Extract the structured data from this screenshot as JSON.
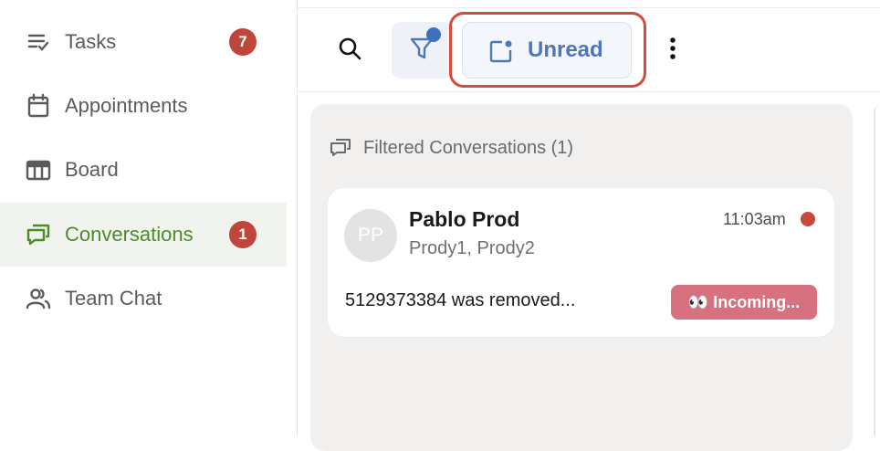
{
  "sidebar": {
    "items": [
      {
        "label": "Tasks",
        "icon": "tasks-icon",
        "badge": "7"
      },
      {
        "label": "Appointments",
        "icon": "calendar-icon"
      },
      {
        "label": "Board",
        "icon": "board-icon"
      },
      {
        "label": "Conversations",
        "icon": "chat-icon",
        "badge": "1",
        "active": true
      },
      {
        "label": "Team Chat",
        "icon": "team-icon"
      }
    ]
  },
  "toolbar": {
    "search_icon": "search-icon",
    "filter_icon": "filter-icon",
    "unread_label": "Unread",
    "unread_icon": "unread-icon",
    "more_icon": "more-vertical-icon"
  },
  "conversations": {
    "header": "Filtered Conversations (1)",
    "items": [
      {
        "avatar_initials": "PP",
        "name": "Pablo Prod",
        "subtitle": "Prody1, Prody2",
        "time": "11:03am",
        "preview": "5129373384 was removed...",
        "status": "👀 Incoming..."
      }
    ]
  },
  "colors": {
    "accent_green": "#4f8a2a",
    "accent_blue": "#4f76b8",
    "badge_red": "#c0463b",
    "highlight_red": "#d64a3a",
    "status_pink": "#d7707f"
  }
}
